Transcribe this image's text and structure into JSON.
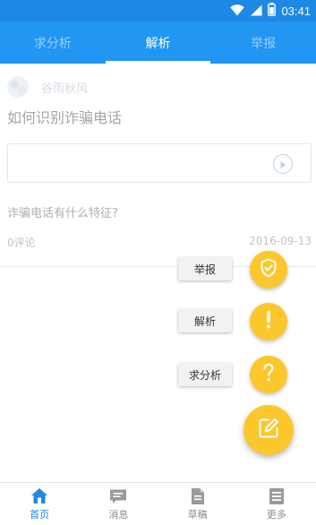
{
  "status_bar": {
    "time": "03:41"
  },
  "tabs": [
    {
      "label": "求分析",
      "active": false
    },
    {
      "label": "解析",
      "active": true
    },
    {
      "label": "举报",
      "active": false
    }
  ],
  "post": {
    "author": "谷雨秋风",
    "title": "如何识别诈骗电话",
    "body": "诈骗电话有什么特征?",
    "comments": "0评论",
    "date": "2016-09-13"
  },
  "fab_menu": [
    {
      "label": "举报",
      "icon": "shield-icon"
    },
    {
      "label": "解析",
      "icon": "exclamation-icon"
    },
    {
      "label": "求分析",
      "icon": "question-icon"
    }
  ],
  "fab_main": {
    "icon": "edit-icon"
  },
  "bottom_nav": [
    {
      "label": "首页",
      "icon": "home-icon",
      "active": true
    },
    {
      "label": "消息",
      "icon": "message-icon",
      "active": false
    },
    {
      "label": "草稿",
      "icon": "draft-icon",
      "active": false
    },
    {
      "label": "更多",
      "icon": "more-icon",
      "active": false
    }
  ],
  "colors": {
    "primary": "#2196f3",
    "status_bar": "#1e88e5",
    "fab": "#fcc72c"
  }
}
